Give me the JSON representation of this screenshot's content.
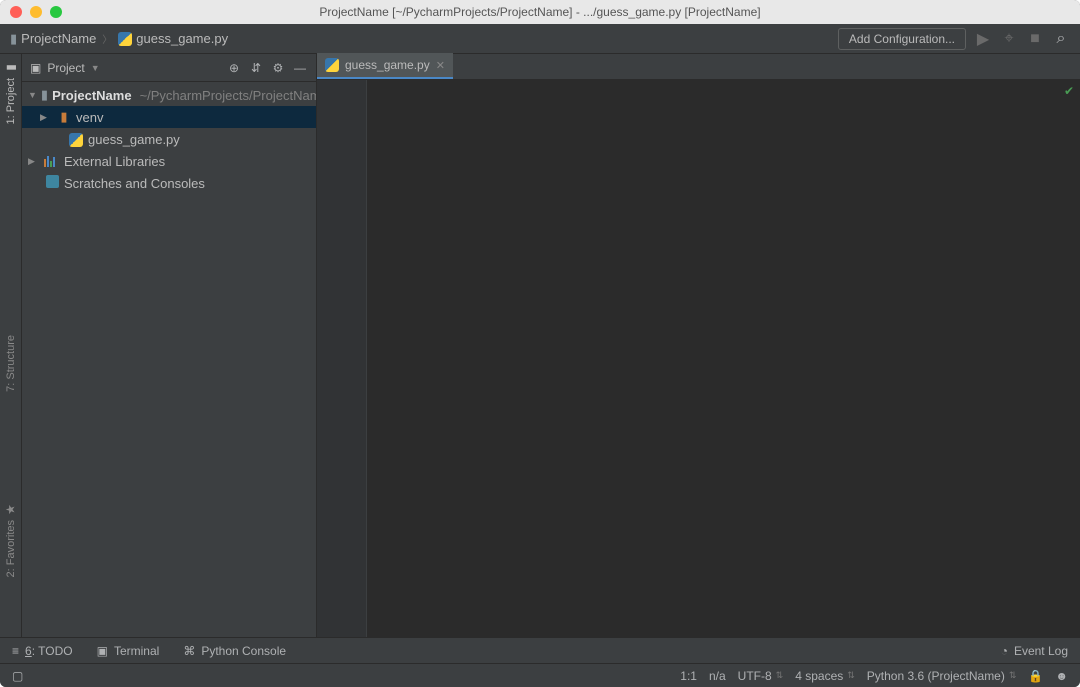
{
  "titlebar": {
    "title": "ProjectName [~/PycharmProjects/ProjectName] - .../guess_game.py [ProjectName]"
  },
  "breadcrumb": {
    "project": "ProjectName",
    "file": "guess_game.py"
  },
  "navbar": {
    "add_config": "Add Configuration..."
  },
  "left_tabs": {
    "project": "1: Project",
    "structure": "7: Structure",
    "favorites": "2: Favorites"
  },
  "sidebar": {
    "header": "Project"
  },
  "tree": {
    "root": "ProjectName",
    "root_path": "~/PycharmProjects/ProjectName",
    "venv": "venv",
    "file": "guess_game.py",
    "external": "External Libraries",
    "scratches": "Scratches and Consoles"
  },
  "tab": {
    "label": "guess_game.py"
  },
  "toolwindows": {
    "todo_num": "6",
    "todo": ": TODO",
    "terminal": "Terminal",
    "pyconsole": "Python Console",
    "eventlog": "Event Log"
  },
  "status": {
    "pos": "1:1",
    "sep": "n/a",
    "encoding": "UTF-8",
    "indent": "4 spaces",
    "interpreter": "Python 3.6 (ProjectName)"
  }
}
